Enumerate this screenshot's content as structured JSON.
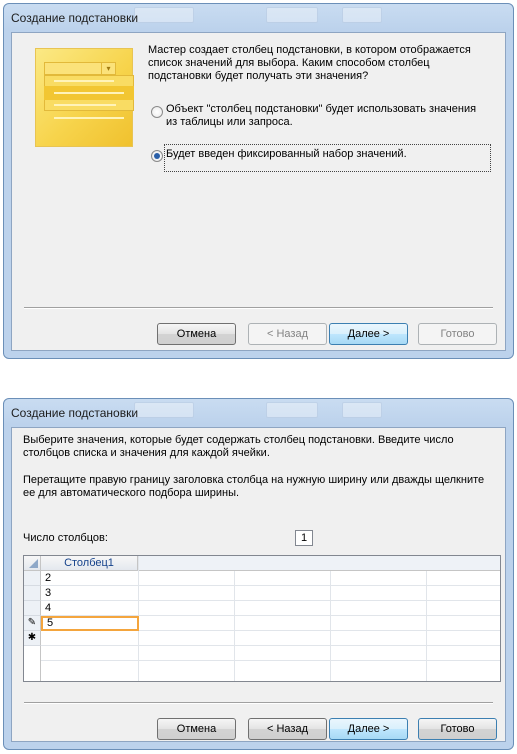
{
  "dialog1": {
    "title": "Создание подстановки",
    "intro_lines": [
      "Мастер создает столбец подстановки, в котором отображается",
      "список значений для выбора.  Каким способом столбец",
      "подстановки будет получать эти значения?"
    ],
    "options": [
      {
        "lines": [
          "Объект \"столбец подстановки\" будет использовать значения",
          "из таблицы или запроса."
        ],
        "checked": false
      },
      {
        "lines": [
          "Будет введен фиксированный набор значений."
        ],
        "checked": true
      }
    ],
    "buttons": {
      "cancel": "Отмена",
      "back": "< Назад",
      "next": "Далее >",
      "finish": "Готово"
    }
  },
  "dialog2": {
    "title": "Создание подстановки",
    "instruction_lines": [
      "Выберите значения, которые будет содержать столбец подстановки. Введите число",
      "столбцов списка и значения для каждой ячейки."
    ],
    "drag_lines": [
      "Перетащите правую границу заголовка столбца на нужную ширину или дважды щелкните",
      "ее для автоматического подбора ширины."
    ],
    "columns_label": "Число столбцов:",
    "columns_value": "1",
    "grid": {
      "column_header": "Столбец1",
      "rows": [
        "2",
        "3",
        "4",
        "5",
        ""
      ],
      "row_markers": [
        "",
        "",
        "",
        "✎",
        "✱"
      ]
    },
    "buttons": {
      "cancel": "Отмена",
      "back": "< Назад",
      "next": "Далее >",
      "finish": "Готово"
    }
  },
  "colors": {
    "titlebar": "#bcd2ec",
    "default_button_border": "#3c7fb1",
    "active_cell": "#f4a53d"
  }
}
